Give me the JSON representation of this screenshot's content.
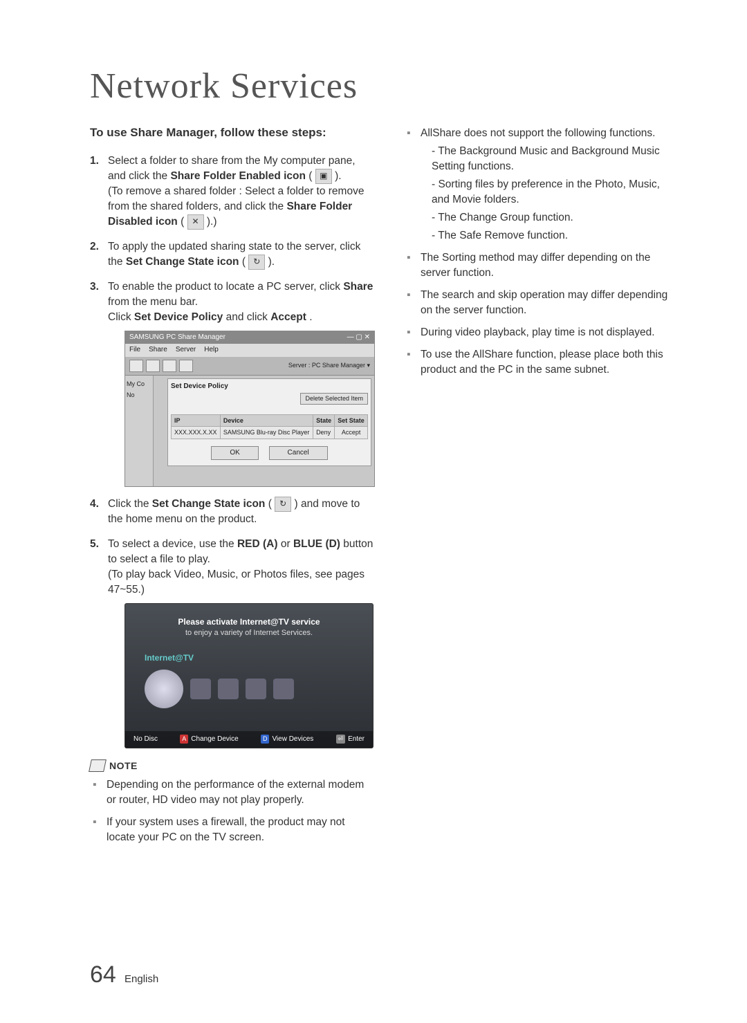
{
  "title": "Network Services",
  "left": {
    "subhead": "To use Share Manager, follow these steps:",
    "steps": [
      {
        "pre": "Select a folder to share from the My computer pane, and click the ",
        "bold1": "Share Folder Enabled icon",
        "post1": " ( ",
        "post1b": " ).",
        "line2a": "(To remove a shared folder : Select a folder to remove from the shared folders, and click the ",
        "bold2": "Share Folder Disabled icon",
        "line2b": " ( ",
        "line2c": " ).)"
      },
      {
        "pre": "To apply the updated sharing state to the server, click the ",
        "bold1": "Set Change State icon",
        "post1": " ( ",
        "post1b": " )."
      },
      {
        "pre": "To enable the product to locate a PC server, click ",
        "bold1": "Share",
        "post1": " from the menu bar.",
        "line2a": "Click ",
        "bold2": "Set Device Policy",
        "line2b": " and click ",
        "bold3": "Accept",
        "line2c": "."
      },
      {
        "pre": "Click the ",
        "bold1": "Set Change State icon",
        "post1": " ( ",
        "post1b": " ) and move to the home menu on the product."
      },
      {
        "pre": "To select a device, use the ",
        "bold1": "RED (A)",
        "post1": " or ",
        "bold2": "BLUE (D)",
        "post2": " button to select a file to play.",
        "line2a": "(To play back Video, Music, or Photos files, see pages 47~55.)"
      }
    ],
    "dialog": {
      "title": "SAMSUNG PC Share Manager",
      "menus": [
        "File",
        "Share",
        "Server",
        "Help"
      ],
      "side": [
        "My Co",
        "No"
      ],
      "panel_title": "Set Device Policy",
      "server": "Server : PC Share Manager  ▾",
      "delete_btn": "Delete Selected Item",
      "headers": [
        "IP",
        "Device",
        "State",
        "Set State"
      ],
      "row": [
        "XXX.XXX.X.XX",
        "SAMSUNG Blu-ray Disc Player",
        "Deny",
        "Accept"
      ],
      "ok": "OK",
      "cancel": "Cancel"
    },
    "tv": {
      "msg1": "Please activate Internet@TV service",
      "msg2": "to enjoy a variety of Internet Services.",
      "label": "Internet@TV",
      "no_disc": "No Disc",
      "change": "Change Device",
      "view": "View Devices",
      "enter": "Enter"
    },
    "note_label": "NOTE",
    "notes": [
      "Depending on the performance of the external modem or router, HD video may not play properly.",
      "If your system uses a firewall, the product may not locate your PC on the TV screen."
    ]
  },
  "right": {
    "bullets": [
      {
        "text": "AllShare does not support the following functions.",
        "dashes": [
          "The Background Music and Background Music Setting functions.",
          "Sorting files by preference in the Photo, Music, and Movie folders.",
          "The Change Group function.",
          "The Safe Remove function."
        ]
      },
      {
        "text": "The Sorting method may differ depending on the server function."
      },
      {
        "text": "The search and skip operation may differ depending on the server function."
      },
      {
        "text": "During video playback, play time is not displayed."
      },
      {
        "text": "To use the AllShare function, please place both this product and the PC in the same subnet."
      }
    ]
  },
  "footer": {
    "num": "64",
    "lang": "English"
  }
}
